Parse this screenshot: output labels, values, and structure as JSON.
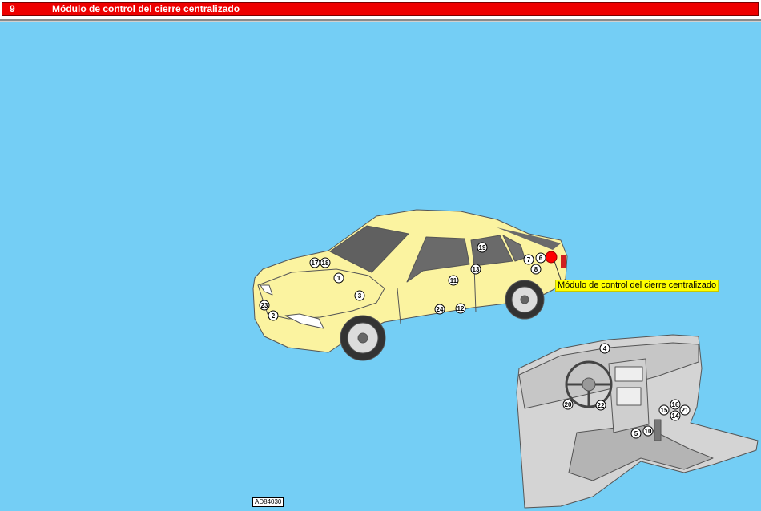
{
  "header": {
    "number": "9",
    "title": "Módulo de control del cierre centralizado"
  },
  "tooltip": "Módulo de control del cierre centralizado",
  "reference_code": "AD84030",
  "callouts": {
    "c1": "1",
    "c2": "2",
    "c3": "3",
    "c4": "4",
    "c5": "5",
    "c6": "6",
    "c7": "7",
    "c8": "8",
    "c10": "10",
    "c11": "11",
    "c12": "12",
    "c13": "13",
    "c14": "14",
    "c15": "15",
    "c16": "16",
    "c17": "17",
    "c18": "18",
    "c19": "19",
    "c20": "20",
    "c21": "21",
    "c22": "22",
    "c23": "23",
    "c24": "24"
  },
  "colors": {
    "header": "#ee0000",
    "background": "#74cef5",
    "car": "#fbf3a0",
    "highlight": "#ff0000",
    "tooltip": "#ffff00"
  }
}
